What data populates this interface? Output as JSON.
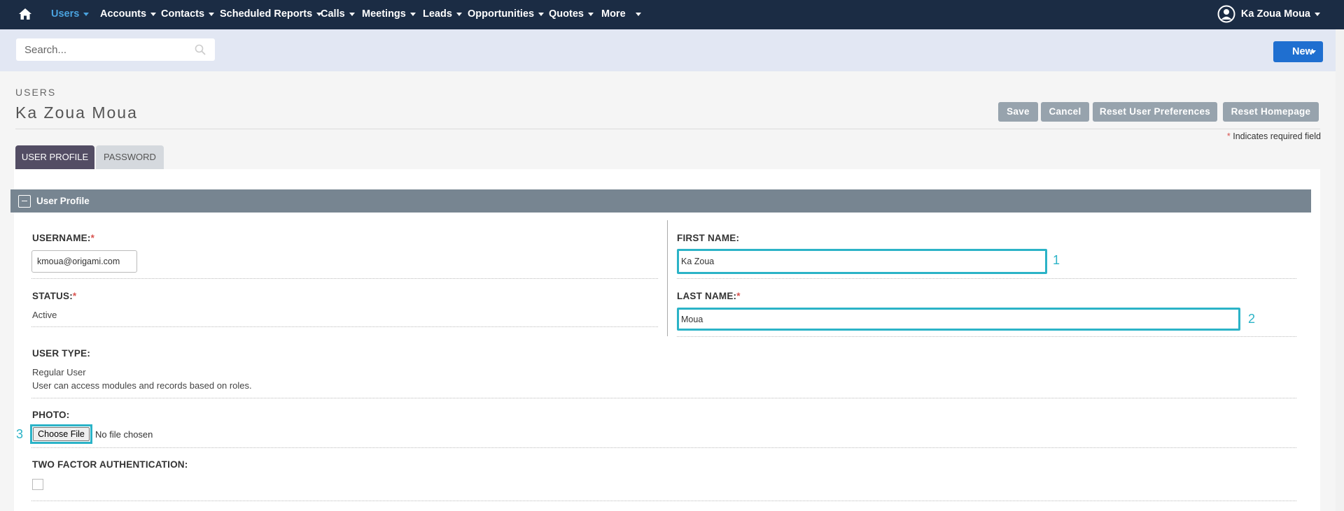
{
  "nav": {
    "items": [
      {
        "label": "Users",
        "active": true
      },
      {
        "label": "Accounts"
      },
      {
        "label": "Contacts"
      },
      {
        "label": "Scheduled Reports"
      },
      {
        "label": "Calls"
      },
      {
        "label": "Meetings"
      },
      {
        "label": "Leads"
      },
      {
        "label": "Opportunities"
      },
      {
        "label": "Quotes"
      },
      {
        "label": "More"
      }
    ],
    "user_name": "Ka Zoua Moua",
    "home_icon": "home-icon",
    "avatar_icon": "user-avatar-icon"
  },
  "search": {
    "placeholder": "Search...",
    "icon": "search-icon"
  },
  "new_button": "New",
  "header": {
    "module": "USERS",
    "record_name": "Ka Zoua Moua",
    "buttons": {
      "save": "Save",
      "cancel": "Cancel",
      "reset_prefs": "Reset User Preferences",
      "reset_home": "Reset Homepage"
    },
    "required_star": "*",
    "required_note": "Indicates required field"
  },
  "tabs": {
    "user_profile": "USER PROFILE",
    "password": "PASSWORD"
  },
  "panel": {
    "title": "User Profile",
    "username_label": "USERNAME:",
    "username_value": "kmoua@origami.com",
    "status_label": "STATUS:",
    "status_value": "Active",
    "first_name_label": "FIRST NAME:",
    "first_name_value": "Ka Zoua",
    "last_name_label": "LAST NAME:",
    "last_name_value": "Moua",
    "user_type_label": "USER TYPE:",
    "user_type_value": "Regular User",
    "user_type_desc": "User can access modules and records based on roles.",
    "photo_label": "PHOTO:",
    "choose_file": "Choose File",
    "no_file": "No file chosen",
    "twofa_label": "TWO FACTOR AUTHENTICATION:",
    "twofa_checked": false,
    "required_star": "*"
  },
  "annotations": {
    "marker1": "1",
    "marker2": "2",
    "marker3": "3",
    "color": "#2bb3c7"
  },
  "colors": {
    "topnav": "#1b2c44",
    "active_nav": "#4aa3df",
    "new_button": "#1f6fd0",
    "tab_active": "#534d64",
    "panel_header": "#778591",
    "action_buttons": "#97a3ad"
  }
}
